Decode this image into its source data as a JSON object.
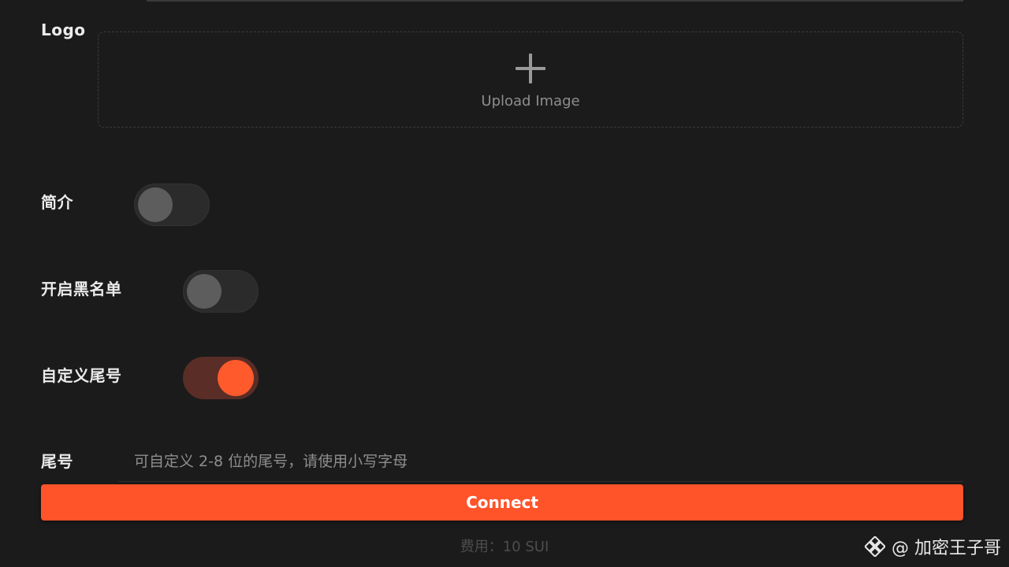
{
  "form": {
    "logo_label": "Logo",
    "upload": {
      "icon": "plus-icon",
      "text": "Upload Image"
    },
    "intro_label": "简介",
    "intro_enabled": false,
    "blacklist_label": "开启黑名单",
    "blacklist_enabled": false,
    "custom_suffix_label": "自定义尾号",
    "custom_suffix_enabled": true,
    "suffix_label": "尾号",
    "suffix_placeholder": "可自定义 2-8 位的尾号，请使用小写字母",
    "suffix_value": ""
  },
  "actions": {
    "connect_label": "Connect"
  },
  "fee": {
    "text": "费用：10 SUI"
  },
  "watermark": {
    "icon": "binance-square-icon",
    "text": "@ 加密王子哥"
  },
  "colors": {
    "background": "#1b1b1b",
    "accent": "#ff532a",
    "toggle_off": "#2b2b2b",
    "toggle_on_track": "#5a2d26",
    "toggle_on_knob": "#ff5a2c"
  }
}
